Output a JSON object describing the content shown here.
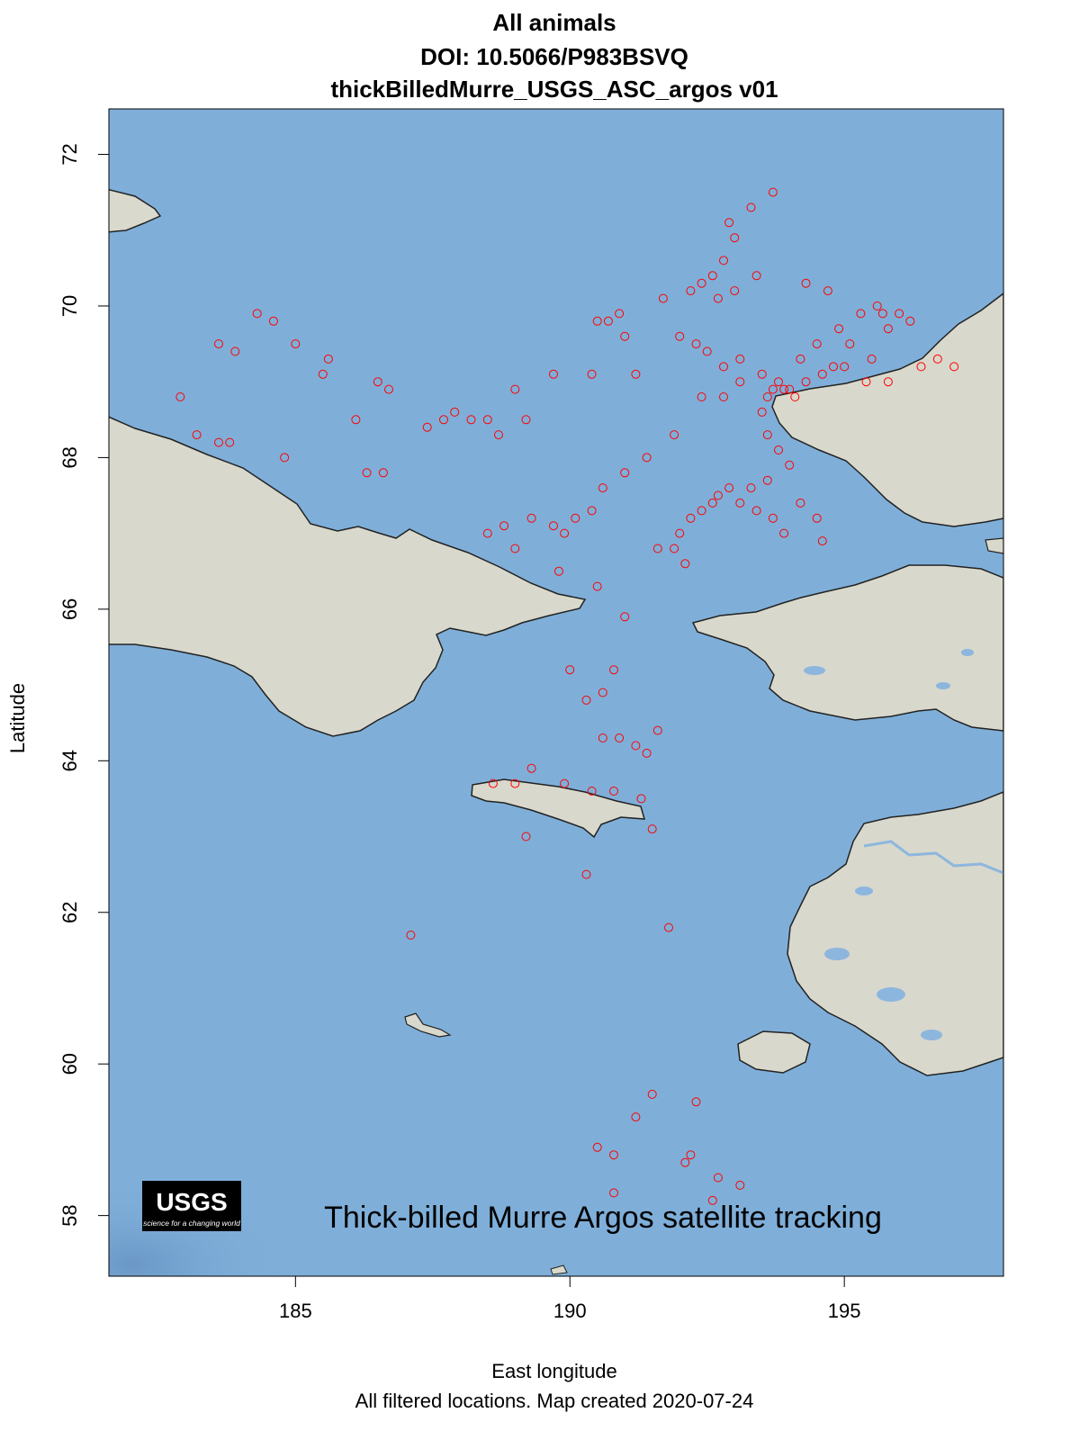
{
  "title": {
    "line1": "All animals",
    "line2": "DOI: 10.5066/P983BSVQ",
    "line3": "thickBilledMurre_USGS_ASC_argos v01"
  },
  "axes": {
    "xlabel": "East longitude",
    "ylabel": "Latitude",
    "xticks": [
      "185",
      "190",
      "195"
    ],
    "yticks": [
      "58",
      "60",
      "62",
      "64",
      "66",
      "68",
      "70",
      "72"
    ]
  },
  "logo": {
    "name": "USGS",
    "tagline": "science for a changing world"
  },
  "map_caption": "Thick-billed Murre Argos satellite tracking",
  "footer": "All filtered locations. Map created  2020-07-24",
  "colors": {
    "water": "#7fafd9",
    "land": "#d8d8cc",
    "points": "#ff0000",
    "lake": "#8db6de"
  },
  "chart_data": {
    "type": "scatter",
    "xlabel": "East longitude",
    "ylabel": "Latitude",
    "xlim": [
      181.6,
      197.9
    ],
    "ylim": [
      57.2,
      72.6
    ],
    "series": [
      {
        "points": [
          [
            193.7,
            71.5
          ],
          [
            193.3,
            71.3
          ],
          [
            192.9,
            71.1
          ],
          [
            193.0,
            70.9
          ],
          [
            192.8,
            70.6
          ],
          [
            192.6,
            70.4
          ],
          [
            192.4,
            70.3
          ],
          [
            192.7,
            70.1
          ],
          [
            193.0,
            70.2
          ],
          [
            192.2,
            70.2
          ],
          [
            191.7,
            70.1
          ],
          [
            190.9,
            69.9
          ],
          [
            190.7,
            69.8
          ],
          [
            190.5,
            69.8
          ],
          [
            191.0,
            69.6
          ],
          [
            192.0,
            69.6
          ],
          [
            192.3,
            69.5
          ],
          [
            192.5,
            69.4
          ],
          [
            192.8,
            69.2
          ],
          [
            193.1,
            69.3
          ],
          [
            193.5,
            69.1
          ],
          [
            193.7,
            68.9
          ],
          [
            193.9,
            68.9
          ],
          [
            194.1,
            68.8
          ],
          [
            193.5,
            68.6
          ],
          [
            193.6,
            68.3
          ],
          [
            193.8,
            68.1
          ],
          [
            194.0,
            67.9
          ],
          [
            193.6,
            67.7
          ],
          [
            193.3,
            67.6
          ],
          [
            192.9,
            67.6
          ],
          [
            192.6,
            67.4
          ],
          [
            192.4,
            67.3
          ],
          [
            192.2,
            67.2
          ],
          [
            192.0,
            67.0
          ],
          [
            191.9,
            66.8
          ],
          [
            192.1,
            66.6
          ],
          [
            191.6,
            66.8
          ],
          [
            192.7,
            67.5
          ],
          [
            193.1,
            67.4
          ],
          [
            193.4,
            67.3
          ],
          [
            193.7,
            67.2
          ],
          [
            194.2,
            67.4
          ],
          [
            194.5,
            67.2
          ],
          [
            194.6,
            66.9
          ],
          [
            193.9,
            67.0
          ],
          [
            194.5,
            69.5
          ],
          [
            194.9,
            69.7
          ],
          [
            195.3,
            69.9
          ],
          [
            195.6,
            70.0
          ],
          [
            195.0,
            69.2
          ],
          [
            195.4,
            69.0
          ],
          [
            195.8,
            69.0
          ],
          [
            194.6,
            69.1
          ],
          [
            194.2,
            69.3
          ],
          [
            195.7,
            69.9
          ],
          [
            196.2,
            69.8
          ],
          [
            196.7,
            69.3
          ],
          [
            197.0,
            69.2
          ],
          [
            196.4,
            69.2
          ],
          [
            193.4,
            70.4
          ],
          [
            194.3,
            70.3
          ],
          [
            194.7,
            70.2
          ],
          [
            193.1,
            69.0
          ],
          [
            192.8,
            68.8
          ],
          [
            192.4,
            68.8
          ],
          [
            191.9,
            68.3
          ],
          [
            191.4,
            68.0
          ],
          [
            191.0,
            67.8
          ],
          [
            190.6,
            67.6
          ],
          [
            190.4,
            67.3
          ],
          [
            190.1,
            67.2
          ],
          [
            189.9,
            67.0
          ],
          [
            189.7,
            67.1
          ],
          [
            189.3,
            67.2
          ],
          [
            189.0,
            66.8
          ],
          [
            188.8,
            67.1
          ],
          [
            188.5,
            67.0
          ],
          [
            189.8,
            66.5
          ],
          [
            190.5,
            66.3
          ],
          [
            191.0,
            65.9
          ],
          [
            190.8,
            65.2
          ],
          [
            190.6,
            64.9
          ],
          [
            190.3,
            64.8
          ],
          [
            190.0,
            65.2
          ],
          [
            191.2,
            64.2
          ],
          [
            191.6,
            64.4
          ],
          [
            191.4,
            64.1
          ],
          [
            190.9,
            64.3
          ],
          [
            190.6,
            64.3
          ],
          [
            190.4,
            63.6
          ],
          [
            190.8,
            63.6
          ],
          [
            191.3,
            63.5
          ],
          [
            189.9,
            63.7
          ],
          [
            189.3,
            63.9
          ],
          [
            189.0,
            63.7
          ],
          [
            188.6,
            63.7
          ],
          [
            189.2,
            63.0
          ],
          [
            191.5,
            63.1
          ],
          [
            190.3,
            62.5
          ],
          [
            191.8,
            61.8
          ],
          [
            187.1,
            61.7
          ],
          [
            191.5,
            59.6
          ],
          [
            192.3,
            59.5
          ],
          [
            191.2,
            59.3
          ],
          [
            190.5,
            58.9
          ],
          [
            190.8,
            58.8
          ],
          [
            192.1,
            58.7
          ],
          [
            192.7,
            58.5
          ],
          [
            193.1,
            58.4
          ],
          [
            190.8,
            58.3
          ],
          [
            192.6,
            58.2
          ],
          [
            192.2,
            58.8
          ],
          [
            184.3,
            69.9
          ],
          [
            184.6,
            69.8
          ],
          [
            185.0,
            69.5
          ],
          [
            185.6,
            69.3
          ],
          [
            183.6,
            69.5
          ],
          [
            183.9,
            69.4
          ],
          [
            185.5,
            69.1
          ],
          [
            186.5,
            69.0
          ],
          [
            186.7,
            68.9
          ],
          [
            182.9,
            68.8
          ],
          [
            183.2,
            68.3
          ],
          [
            183.6,
            68.2
          ],
          [
            183.8,
            68.2
          ],
          [
            184.8,
            68.0
          ],
          [
            186.1,
            68.5
          ],
          [
            186.3,
            67.8
          ],
          [
            186.6,
            67.8
          ],
          [
            187.4,
            68.4
          ],
          [
            187.7,
            68.5
          ],
          [
            187.9,
            68.6
          ],
          [
            188.2,
            68.5
          ],
          [
            188.5,
            68.5
          ],
          [
            188.7,
            68.3
          ],
          [
            189.2,
            68.5
          ],
          [
            189.0,
            68.9
          ],
          [
            189.7,
            69.1
          ],
          [
            190.4,
            69.1
          ],
          [
            191.2,
            69.1
          ],
          [
            193.6,
            68.8
          ],
          [
            193.8,
            69.0
          ],
          [
            194.3,
            69.0
          ],
          [
            194.8,
            69.2
          ],
          [
            195.1,
            69.5
          ],
          [
            195.5,
            69.3
          ],
          [
            195.8,
            69.7
          ],
          [
            196.0,
            69.9
          ],
          [
            194.0,
            68.9
          ]
        ]
      }
    ]
  }
}
